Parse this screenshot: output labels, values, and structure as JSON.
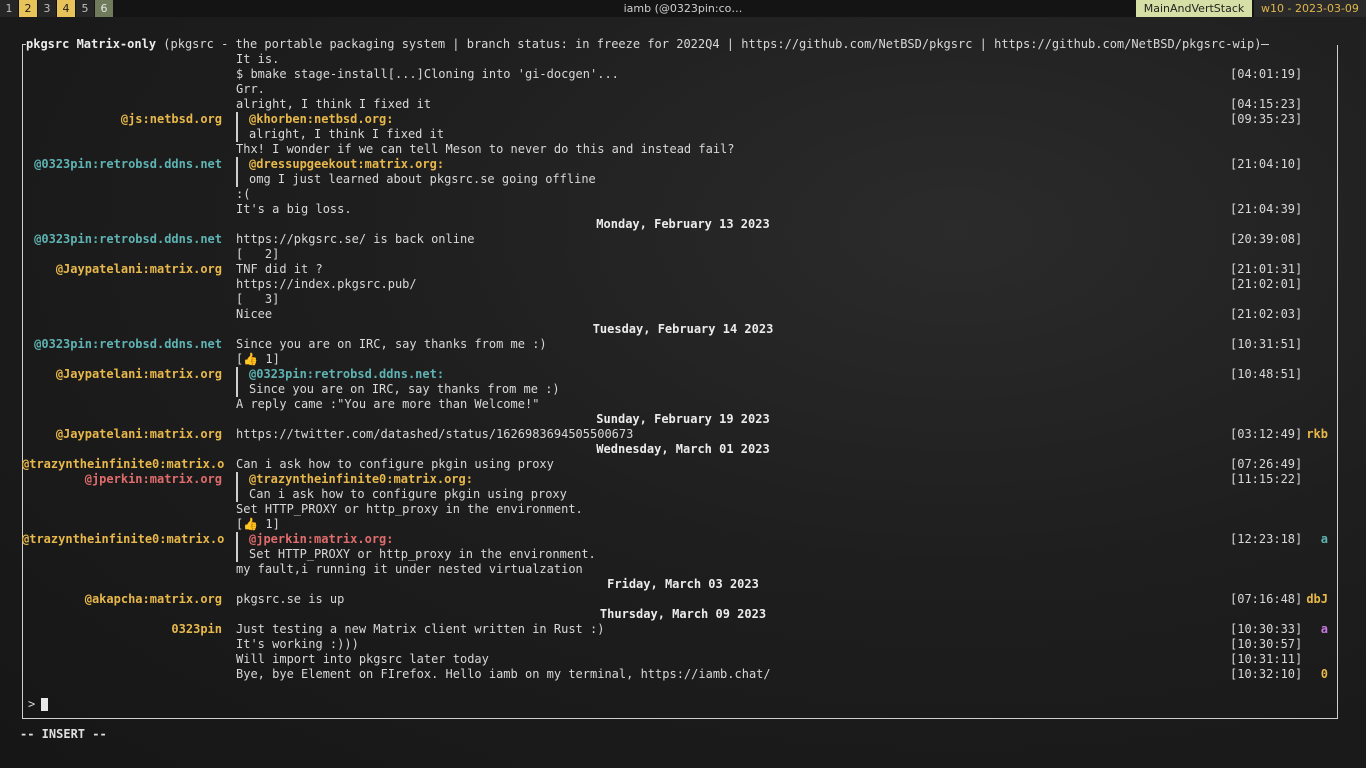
{
  "topbar": {
    "workspaces": [
      {
        "label": "1",
        "state": "normal"
      },
      {
        "label": "2",
        "state": "active"
      },
      {
        "label": "3",
        "state": "normal"
      },
      {
        "label": "4",
        "state": "active"
      },
      {
        "label": "5",
        "state": "normal"
      },
      {
        "label": "6",
        "state": "occupied"
      }
    ],
    "window_title": "iamb (@0323pin:co…",
    "layout": "MainAndVertStack",
    "clock": "w10 - 2023-03-09"
  },
  "room": {
    "name": "pkgsrc Matrix-only",
    "topic": "(pkgsrc - the portable packaging system | branch status: in freeze for 2022Q4 | https://github.com/NetBSD/pkgsrc | https://github.com/NetBSD/pkgsrc-wip)"
  },
  "colors": {
    "yellow": "#e8b84a",
    "teal": "#5fb3b3",
    "red": "#e06c6c",
    "magenta": "#c678dd",
    "text": "#d8d8d8"
  },
  "lines": [
    {
      "kind": "msg",
      "text": "It is."
    },
    {
      "kind": "msg",
      "text": "$ bmake stage-install[...]Cloning into 'gi-docgen'...",
      "ts": "[04:01:19]"
    },
    {
      "kind": "msg",
      "text": "Grr."
    },
    {
      "kind": "msg",
      "text": "alright, I think I fixed it",
      "ts": "[04:15:23]"
    },
    {
      "kind": "quote-head",
      "sender": "@js:netbsd.org",
      "sender_color": "yellow",
      "text": "@khorben:netbsd.org:",
      "text_color": "yellow",
      "ts": "[09:35:23]"
    },
    {
      "kind": "quote",
      "text": "alright, I think I fixed it"
    },
    {
      "kind": "msg",
      "text": "Thx! I wonder if we can tell Meson to never do this and instead fail?"
    },
    {
      "kind": "quote-head",
      "sender": "@0323pin:retrobsd.ddns.net",
      "sender_color": "teal",
      "text": "@dressupgeekout:matrix.org:",
      "text_color": "yellow",
      "ts": "[21:04:10]"
    },
    {
      "kind": "quote",
      "text": "omg I just learned about pkgsrc.se going offline"
    },
    {
      "kind": "msg",
      "text": ":("
    },
    {
      "kind": "msg",
      "text": "It's a big loss.",
      "ts": "[21:04:39]"
    },
    {
      "kind": "date",
      "text": "Monday, February 13 2023"
    },
    {
      "kind": "msg",
      "sender": "@0323pin:retrobsd.ddns.net",
      "sender_color": "teal",
      "text": "https://pkgsrc.se/ is back online",
      "ts": "[20:39:08]"
    },
    {
      "kind": "msg",
      "text": "[   2]"
    },
    {
      "kind": "msg",
      "sender": "@Jaypatelani:matrix.org",
      "sender_color": "yellow",
      "text": "TNF did it ?",
      "ts": "[21:01:31]"
    },
    {
      "kind": "msg",
      "text": "https://index.pkgsrc.pub/",
      "ts": "[21:02:01]"
    },
    {
      "kind": "msg",
      "text": "[   3]"
    },
    {
      "kind": "msg",
      "text": "Nicee",
      "ts": "[21:02:03]"
    },
    {
      "kind": "date",
      "text": "Tuesday, February 14 2023"
    },
    {
      "kind": "msg",
      "sender": "@0323pin:retrobsd.ddns.net",
      "sender_color": "teal",
      "text": "Since you are on IRC, say thanks from me :)",
      "ts": "[10:31:51]"
    },
    {
      "kind": "msg",
      "text": "[👍 1]"
    },
    {
      "kind": "quote-head",
      "sender": "@Jaypatelani:matrix.org",
      "sender_color": "yellow",
      "text": "@0323pin:retrobsd.ddns.net:",
      "text_color": "teal",
      "ts": "[10:48:51]"
    },
    {
      "kind": "quote",
      "text": "Since you are on IRC, say thanks from me :)"
    },
    {
      "kind": "msg",
      "text": "A reply came :\"You are more than Welcome!\""
    },
    {
      "kind": "date",
      "text": "Sunday, February 19 2023"
    },
    {
      "kind": "msg",
      "sender": "@Jaypatelani:matrix.org",
      "sender_color": "yellow",
      "text": "https://twitter.com/datashed/status/1626983694505500673",
      "ts": "[03:12:49]",
      "receipt": "rkb",
      "receipt_color": "yellow"
    },
    {
      "kind": "date",
      "text": "Wednesday, March 01 2023"
    },
    {
      "kind": "msg",
      "sender": "@trazyntheinfinite0:matrix.o",
      "sender_color": "yellow",
      "text": "Can i ask how to configure pkgin using proxy",
      "ts": "[07:26:49]"
    },
    {
      "kind": "quote-head",
      "sender": "@jperkin:matrix.org",
      "sender_color": "red",
      "text": "@trazyntheinfinite0:matrix.org:",
      "text_color": "yellow",
      "ts": "[11:15:22]"
    },
    {
      "kind": "quote",
      "text": "Can i ask how to configure pkgin using proxy"
    },
    {
      "kind": "msg",
      "text": "Set HTTP_PROXY or http_proxy in the environment."
    },
    {
      "kind": "msg",
      "text": "[👍 1]"
    },
    {
      "kind": "quote-head",
      "sender": "@trazyntheinfinite0:matrix.o",
      "sender_color": "yellow",
      "text": "@jperkin:matrix.org:",
      "text_color": "red",
      "ts": "[12:23:18]",
      "receipt": "a",
      "receipt_color": "teal"
    },
    {
      "kind": "quote",
      "text": "Set HTTP_PROXY or http_proxy in the environment."
    },
    {
      "kind": "msg",
      "text": "my fault,i running it under nested virtualzation"
    },
    {
      "kind": "date",
      "text": "Friday, March 03 2023"
    },
    {
      "kind": "msg",
      "sender": "@akapcha:matrix.org",
      "sender_color": "yellow",
      "text": "pkgsrc.se is up",
      "ts": "[07:16:48]",
      "receipt": "dbJ",
      "receipt_color": "yellow"
    },
    {
      "kind": "date",
      "text": "Thursday, March 09 2023"
    },
    {
      "kind": "msg",
      "sender": "0323pin",
      "sender_color": "yellow",
      "text": "Just testing a new Matrix client written in Rust :)",
      "ts": "[10:30:33]",
      "receipt": "a",
      "receipt_color": "magenta"
    },
    {
      "kind": "msg",
      "text": "It's working :)))",
      "ts": "[10:30:57]"
    },
    {
      "kind": "msg",
      "text": "Will import into pkgsrc later today",
      "ts": "[10:31:11]"
    },
    {
      "kind": "msg",
      "text": "Bye, bye Element on FIrefox. Hello iamb on my terminal, https://iamb.chat/",
      "ts": "[10:32:10]",
      "receipt": "0",
      "receipt_color": "yellow"
    }
  ],
  "composer": {
    "prompt": ">",
    "value": ""
  },
  "mode": "-- INSERT --"
}
